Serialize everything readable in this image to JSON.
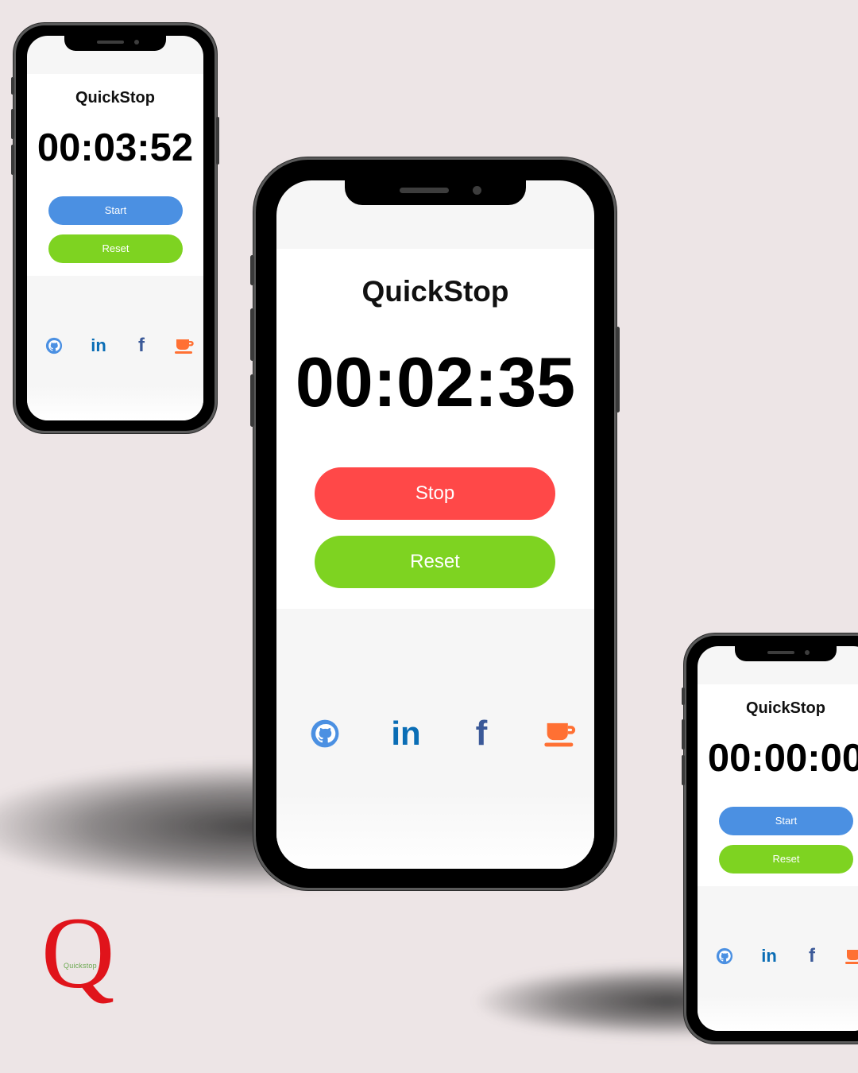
{
  "app": {
    "title": "QuickStop",
    "logo_letter": "Q",
    "logo_wordmark": "Quickstop"
  },
  "colors": {
    "background": "#ede5e6",
    "start": "#4b90e2",
    "reset": "#7ed321",
    "stop": "#ff4848",
    "github": "#4b90e2",
    "linkedin": "#0a6db5",
    "facebook": "#3b5998",
    "coffee": "#ff7033",
    "logo": "#e0141b"
  },
  "phones": {
    "left": {
      "title": "QuickStop",
      "time": "00:03:52",
      "primary_button": "Start",
      "secondary_button": "Reset"
    },
    "center": {
      "title": "QuickStop",
      "time": "00:02:35",
      "primary_button": "Stop",
      "secondary_button": "Reset"
    },
    "right": {
      "title": "QuickStop",
      "time": "00:00:00",
      "primary_button": "Start",
      "secondary_button": "Reset"
    }
  },
  "social_links": [
    "github-icon",
    "linkedin-icon",
    "facebook-icon",
    "coffee-icon"
  ]
}
